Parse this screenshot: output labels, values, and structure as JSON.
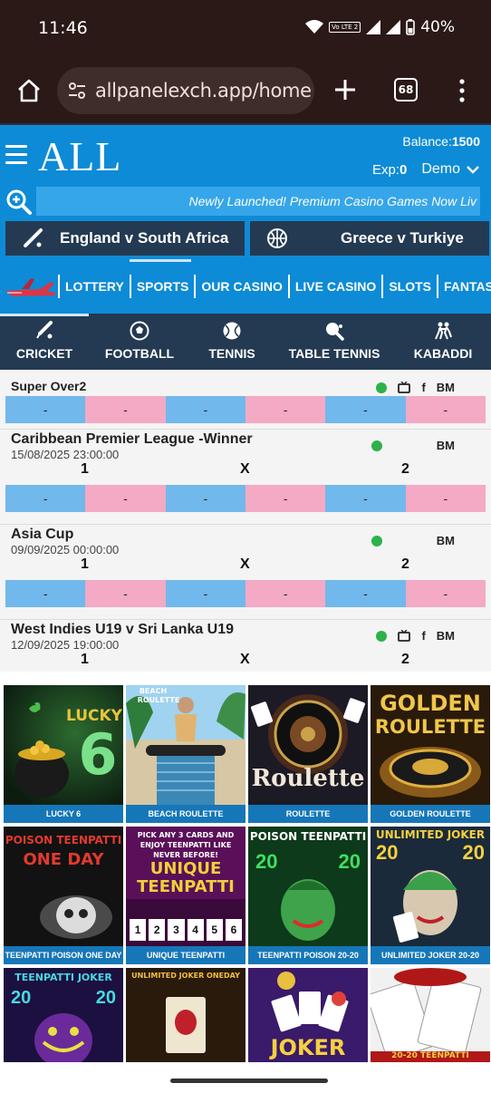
{
  "status": {
    "time": "11:46",
    "battery": "40%",
    "volte": "Vo LTE 2"
  },
  "browser": {
    "url": "allpanelexch.app/home",
    "tab_count": "68"
  },
  "header": {
    "logo": "ALL",
    "balance_label": "Balance:",
    "balance_value": "1500",
    "exp_label": "Exp:",
    "exp_value": "0",
    "demo_label": "Demo",
    "marquee": "Newly Launched! Premium Casino Games Now Liv"
  },
  "featured": [
    {
      "label": "England v South Africa",
      "icon": "cricket-bat-icon"
    },
    {
      "label": "Greece v Turkiye",
      "icon": "basketball-icon"
    }
  ],
  "nav": [
    "LOTTERY",
    "SPORTS",
    "OUR CASINO",
    "LIVE CASINO",
    "SLOTS",
    "FANTASY"
  ],
  "sports_tabs": [
    {
      "label": "CRICKET",
      "icon": "cricket-icon"
    },
    {
      "label": "FOOTBALL",
      "icon": "football-icon"
    },
    {
      "label": "TENNIS",
      "icon": "tennis-icon"
    },
    {
      "label": "TABLE TENNIS",
      "icon": "table-tennis-icon"
    },
    {
      "label": "KABADDI",
      "icon": "kabaddi-icon"
    }
  ],
  "matches": [
    {
      "title": "Super Over2",
      "date": "",
      "icons": [
        "live-dot",
        "tv-icon",
        "f",
        "BM"
      ],
      "labels": false
    },
    {
      "title": "Caribbean Premier League -Winner",
      "date": "15/08/2025 23:00:00",
      "icons": [
        "live-dot",
        "BM"
      ],
      "labels": true
    },
    {
      "title": "Asia Cup",
      "date": "09/09/2025 00:00:00",
      "icons": [
        "live-dot",
        "BM"
      ],
      "labels": true
    },
    {
      "title": "West Indies U19 v Sri Lanka U19",
      "date": "12/09/2025 19:00:00",
      "icons": [
        "live-dot",
        "tv-icon",
        "f",
        "BM"
      ],
      "labels": true
    }
  ],
  "odds_labels": {
    "one": "1",
    "x": "X",
    "two": "2",
    "empty": "-"
  },
  "bm_label": "BM",
  "f_label": "f",
  "casino": [
    {
      "caption": "LUCKY 6",
      "art": "LUCKY 6"
    },
    {
      "caption": "BEACH ROULETTE",
      "art": "BEACH ROULETTE"
    },
    {
      "caption": "ROULETTE",
      "art": "Roulette"
    },
    {
      "caption": "GOLDEN ROULETTE",
      "art": "GOLDEN ROULETTE"
    },
    {
      "caption": "TEENPATTI POISON ONE DAY",
      "art": "POISON TEENPATTI ONE DAY"
    },
    {
      "caption": "UNIQUE TEENPATTI",
      "art": "UNIQUE TEENPATTI"
    },
    {
      "caption": "TEENPATTI POISON 20-20",
      "art": "POISON TEENPATTI 20 20"
    },
    {
      "caption": "UNLIMITED JOKER 20-20",
      "art": "UNLIMITED JOKER 20 20"
    },
    {
      "caption": "",
      "art": "TEENPATTI JOKER 20 20"
    },
    {
      "caption": "",
      "art": "UNLIMITED JOKER ONEDAY"
    },
    {
      "caption": "",
      "art": "JOKER"
    },
    {
      "caption": "",
      "art": "20-20 TEENPATTI"
    }
  ],
  "casino_art_text": {
    "lucky": "LUCKY",
    "six": "6",
    "beach": "BEACH",
    "roulette_small": "ROULETTE",
    "roulette_big": "Roulette",
    "golden": "GOLDEN",
    "golden_roulette": "ROULETTE",
    "poison1": "POISON TEENPATTI",
    "oneday": "ONE DAY",
    "pick": "PICK ANY 3 CARDS AND ENJOY TEENPATTI LIKE NEVER BEFORE!",
    "unique": "UNIQUE",
    "teenpatti": "TEENPATTI",
    "digits": [
      "1",
      "2",
      "3",
      "4",
      "5",
      "6"
    ],
    "poison2": "POISON TEENPATTI",
    "twenty": "20",
    "unlimited_joker": "UNLIMITED JOKER",
    "tp_joker": "TEENPATTI JOKER",
    "unlimited_oneday": "UNLIMITED JOKER ONEDAY",
    "joker": "JOKER",
    "tp2020": "20-20 TEENPATTI"
  }
}
